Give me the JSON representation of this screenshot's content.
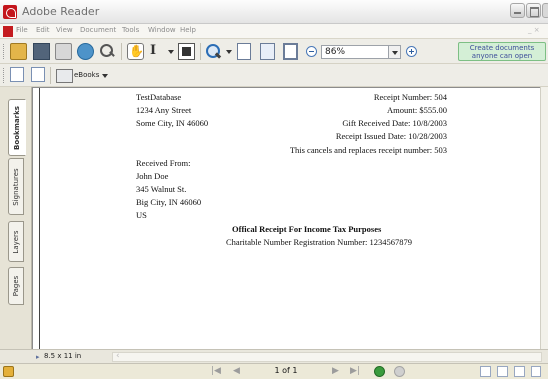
{
  "window": {
    "title": "Adobe Reader"
  },
  "menu": [
    "File",
    "Edit",
    "View",
    "Document",
    "Tools",
    "Window",
    "Help"
  ],
  "menu_right": "_ ×",
  "toolbar": {
    "zoom_value": "86%",
    "promo_line1": "Create documents",
    "promo_line2": "anyone can open",
    "ebooks_label": "eBooks"
  },
  "nav_tabs": [
    "Bookmarks",
    "Signatures",
    "Layers",
    "Pages"
  ],
  "document": {
    "org_name": "TestDatabase",
    "org_street": "1234 Any Street",
    "org_city": "Some City, IN 46060",
    "receipt_number": "Receipt Number: 504",
    "amount": "Amount: $555.00",
    "gift_date": "Gift Received Date: 10/8/2003",
    "issued_date": "Receipt Issued Date: 10/28/2003",
    "replaces": "This cancels and replaces receipt number: 503",
    "received_from_label": "Received From:",
    "donor_name": "John Doe",
    "donor_street": "345 Walnut St.",
    "donor_city": "Big City, IN 46060",
    "donor_country": "US",
    "heading": "Offical Receipt For Income Tax Purposes",
    "charity_reg": "Charitable Number Registration Number: 1234567879"
  },
  "status": {
    "page_size": "8.5 x 11 in",
    "page_indicator": "1 of 1"
  },
  "colors": {
    "titlebar_icon": "#c4151c",
    "promo_bg": "#d4efd6",
    "promo_text": "#3d4d9a",
    "go_green": "#3a9b3d"
  }
}
